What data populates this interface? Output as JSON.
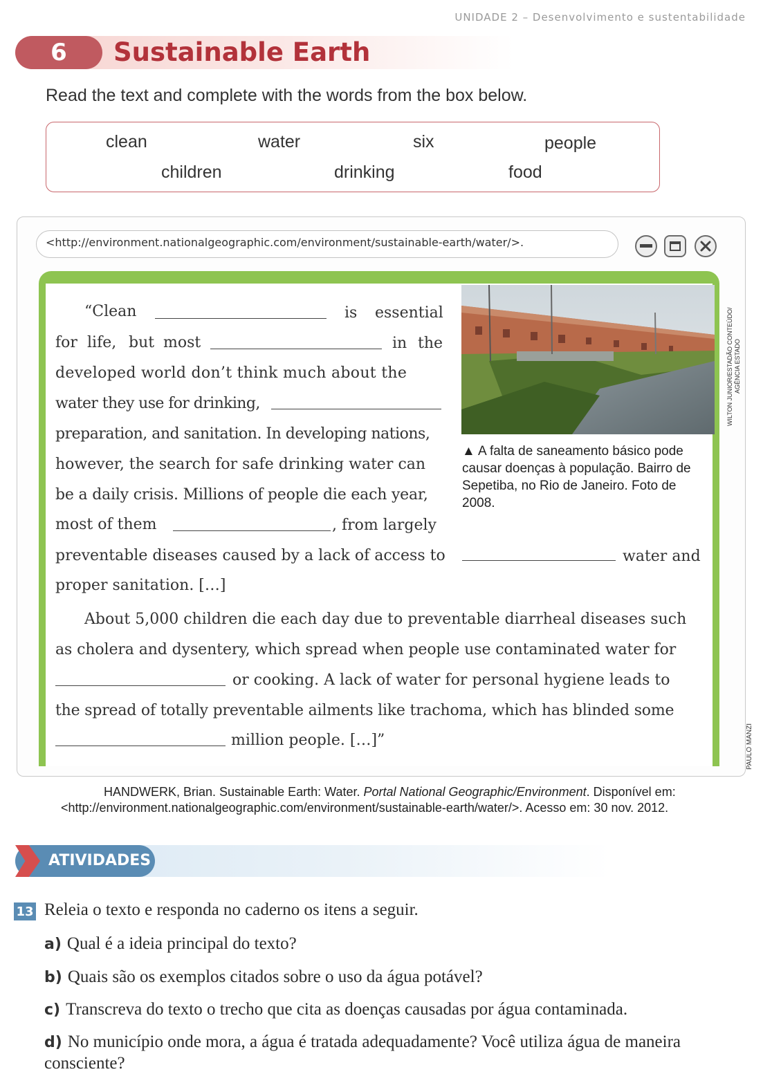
{
  "unit_header": "UNIDADE 2 – Desenvolvimento e sustentabilidade",
  "section": {
    "number": "6",
    "title": "Sustainable Earth"
  },
  "instruction": "Read the text and complete with the words from the box below.",
  "word_box": [
    "clean",
    "water",
    "six",
    "people",
    "children",
    "drinking",
    "food"
  ],
  "browser": {
    "url": "<http://environment.nationalgeographic.com/environment/sustainable-earth/water/>.",
    "buttons": {
      "minimize": "minimize-icon",
      "maximize": "maximize-icon",
      "close": "close-icon"
    }
  },
  "text": {
    "l1a": "“Clean",
    "l1b": "is",
    "l1c": "essential",
    "l2a": "for",
    "l2b": "life,",
    "l2c": "but",
    "l2d": "most",
    "l2e": "in",
    "l2f": "the",
    "l3": "developed  world  don’t  think  much  about  the",
    "l4": "water they use for drinking,",
    "l5": "preparation, and sanitation. In developing nations,",
    "l6": "however, the search for safe drinking water can",
    "l7": "be a daily crisis. Millions of people die each year,",
    "l8a": "most  of  them",
    "l8b": ", from largely",
    "l9a": "preventable diseases caused by a lack of access to",
    "l9b": "water and",
    "l10": "proper sanitation. […]",
    "l11": "About 5,000 children die each day due to preventable diarrheal diseases such",
    "l12": "as cholera and dysentery, which spread when people use contaminated water for",
    "l13": "or cooking. A lack of water for personal hygiene leads to",
    "l14": "the spread of totally preventable ailments like trachoma, which has blinded some",
    "l15": "million people. […]”"
  },
  "photo": {
    "credit": "WILTON JUNIOR/ESTADÃO CONTEÚDO/ AGÊNCIA ESTADO",
    "caption": "▲ A falta de saneamento básico pode causar doenças à população. Bairro de Sepetiba, no Rio de Janeiro. Foto de 2008."
  },
  "side_credit": "PAULO MANZI",
  "reference": {
    "line1_pre": "HANDWERK, Brian. Sustainable Earth: Water. ",
    "line1_italic": "Portal National Geographic/Environment",
    "line1_post": ". Disponível em:",
    "line2": "<http://environment.nationalgeographic.com/environment/sustainable-earth/water/>. Acesso em: 30 nov. 2012."
  },
  "activities": {
    "heading": "ATIVIDADES",
    "question_number": "13",
    "question": "Releia o  texto e responda no caderno os itens a seguir.",
    "items": [
      {
        "letter": "a)",
        "text": "Qual é a ideia principal do texto?"
      },
      {
        "letter": "b)",
        "text": "Quais são os exemplos citados sobre o uso da água potável?"
      },
      {
        "letter": "c)",
        "text": "Transcreva do texto o trecho que cita as doenças causadas por água contaminada."
      },
      {
        "letter": "d)",
        "text": "No município onde mora, a água é tratada adequadamente? Você utiliza água de maneira consciente?"
      }
    ]
  }
}
